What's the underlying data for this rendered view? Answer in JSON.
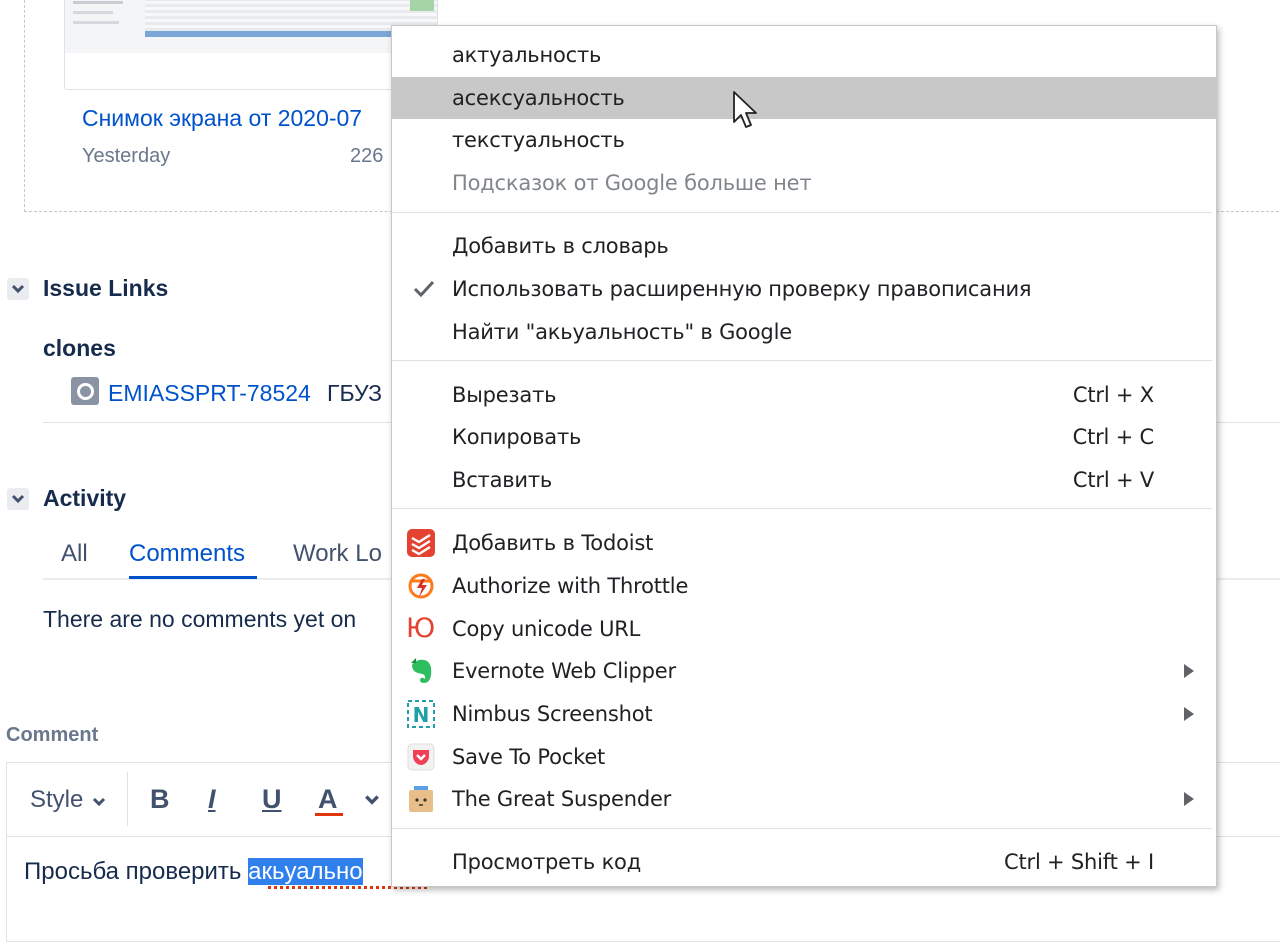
{
  "attachment": {
    "name": "Снимок экрана от 2020-07",
    "date": "Yesterday",
    "size": "226"
  },
  "issue_links": {
    "title": "Issue Links",
    "relation": "clones",
    "key": "EMIASSPRT-78524",
    "summary": "ГБУЗ"
  },
  "activity": {
    "title": "Activity",
    "tabs": [
      "All",
      "Comments",
      "Work Lo"
    ],
    "active_tab": "Comments",
    "empty_text": "There are no comments yet on"
  },
  "comment": {
    "label": "Comment",
    "toolbar": {
      "style": "Style",
      "bold": "B",
      "italic": "I",
      "underline": "U",
      "color": "A"
    },
    "text_before": "Просьба проверить ",
    "text_selected": "акьуально"
  },
  "context_menu": {
    "suggestions": [
      "актуальность",
      "асексуальность",
      "текстуальность"
    ],
    "no_more": "Подсказок от Google больше нет",
    "add_dictionary": "Добавить в словарь",
    "enhanced_spell": "Использовать расширенную проверку правописания",
    "search_google": "Найти \"акьуальность\" в Google",
    "cut": {
      "label": "Вырезать",
      "shortcut": "Ctrl + X"
    },
    "copy": {
      "label": "Копировать",
      "shortcut": "Ctrl + C"
    },
    "paste": {
      "label": "Вставить",
      "shortcut": "Ctrl + V"
    },
    "extensions": [
      {
        "label": "Добавить в Todoist",
        "icon": "todoist-icon",
        "submenu": false
      },
      {
        "label": "Authorize with Throttle",
        "icon": "throttle-icon",
        "submenu": false
      },
      {
        "label": "Copy unicode URL",
        "icon": "unicode-url-icon",
        "submenu": false
      },
      {
        "label": "Evernote Web Clipper",
        "icon": "evernote-icon",
        "submenu": true
      },
      {
        "label": "Nimbus Screenshot",
        "icon": "nimbus-icon",
        "submenu": true
      },
      {
        "label": "Save To Pocket",
        "icon": "pocket-icon",
        "submenu": false
      },
      {
        "label": "The Great Suspender",
        "icon": "great-suspender-icon",
        "submenu": true
      }
    ],
    "unicode_icon_glyph": "Ю",
    "nimbus_icon_glyph": "N",
    "inspect": {
      "label": "Просмотреть код",
      "shortcut": "Ctrl + Shift + I"
    }
  },
  "colors": {
    "link": "#0052cc",
    "hover": "#c8c8c8",
    "selection": "#2f80ed",
    "todoist": "#e44332",
    "evernote": "#2dbe60",
    "pocket": "#ef4056",
    "nimbus": "#1fa0a8"
  }
}
